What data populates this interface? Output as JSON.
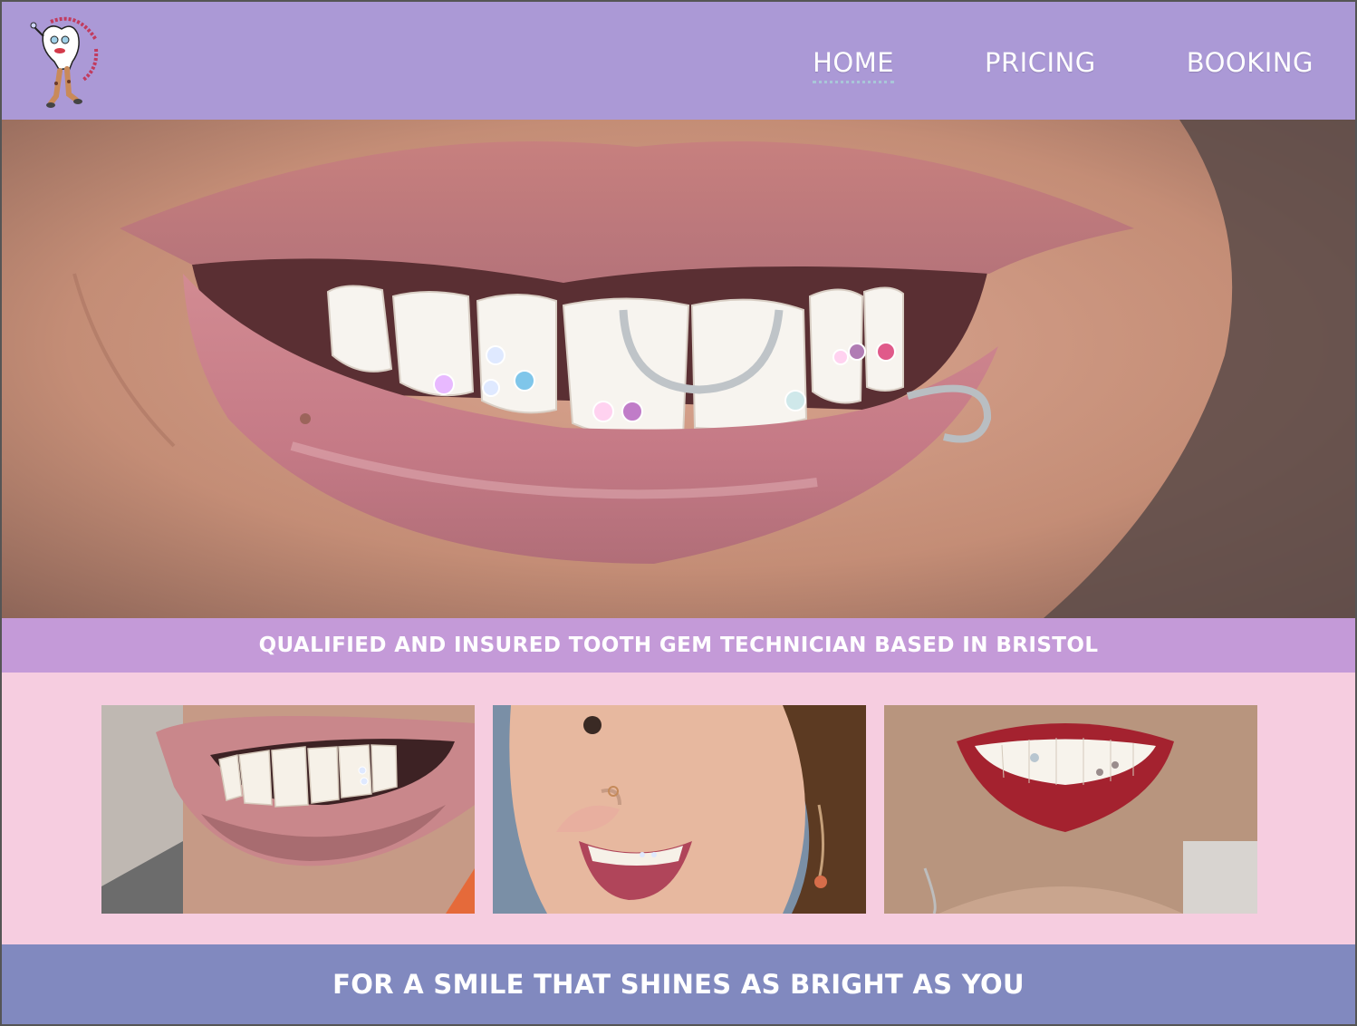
{
  "colors": {
    "header_bg": "#ab99d6",
    "tagline_bg": "#c49ad8",
    "gallery_bg": "#f6cde0",
    "footer_bg": "#8189bf",
    "nav_active_underline": "#a9c7d9"
  },
  "header": {
    "logo_icon": "tooth-character-logo",
    "nav": [
      {
        "label": "HOME",
        "active": true
      },
      {
        "label": "PRICING",
        "active": false
      },
      {
        "label": "BOOKING",
        "active": false
      }
    ]
  },
  "hero": {
    "image": "close-up-smile-with-tooth-gems-and-lip-ring"
  },
  "tagline": "QUALIFIED AND INSURED TOOTH GEM TECHNICIAN BASED IN BRISTOL",
  "gallery": {
    "photos": [
      "smile-with-single-tooth-gem",
      "laughing-woman-with-star-tooth-gem",
      "red-lipstick-smile-with-heart-gems"
    ]
  },
  "footer": {
    "slogan": "FOR A SMILE THAT SHINES AS BRIGHT AS YOU"
  }
}
